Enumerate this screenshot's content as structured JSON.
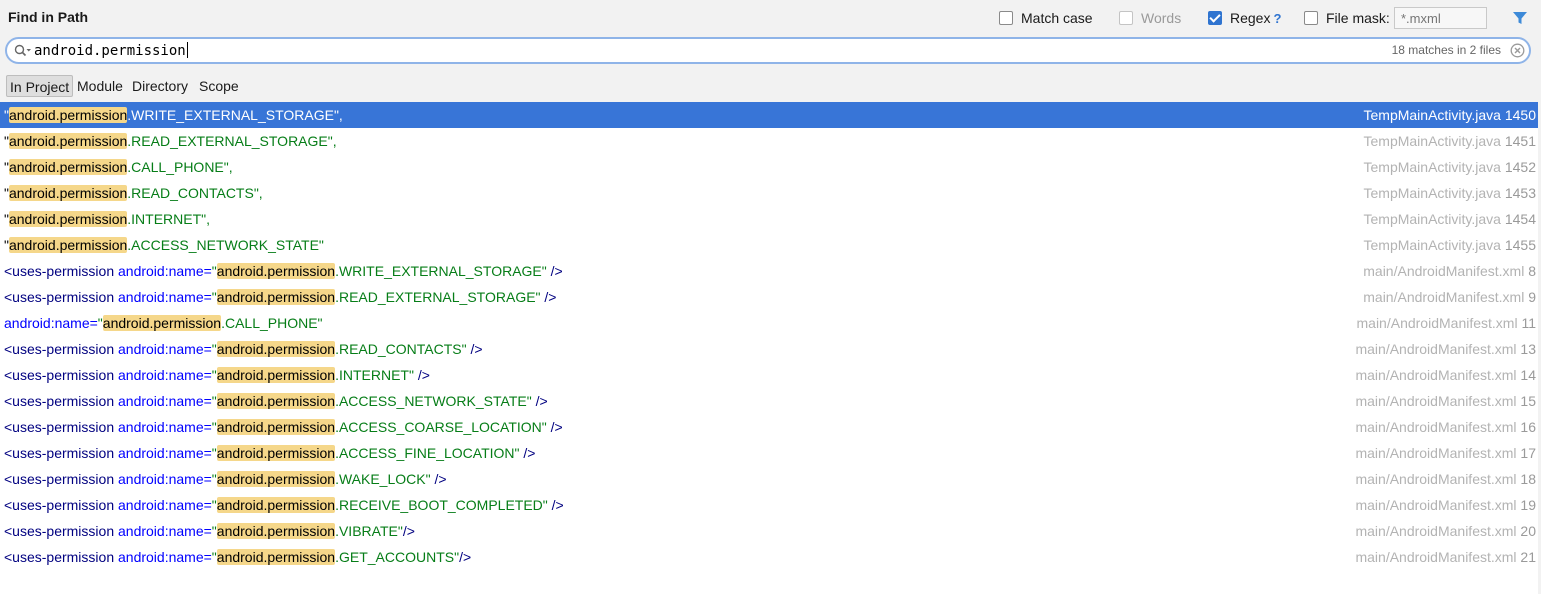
{
  "dialog": {
    "title": "Find in Path",
    "options": {
      "match_case": {
        "label": "Match case",
        "checked": false,
        "disabled": false
      },
      "words": {
        "label": "Words",
        "checked": false,
        "disabled": true
      },
      "regex": {
        "label": "Regex",
        "help": "?",
        "checked": true,
        "disabled": false
      },
      "file_mask": {
        "label": "File mask:",
        "checked": false,
        "placeholder": "*.mxml"
      }
    },
    "filter_icon": "filter-icon"
  },
  "search": {
    "query": "android.permission",
    "match_count": "18 matches in 2 files",
    "icon": "search-icon",
    "clear_icon": "clear-icon"
  },
  "scopes": [
    {
      "label": "In Project",
      "active": true
    },
    {
      "label": "Module",
      "active": false
    },
    {
      "label": "Directory",
      "active": false
    },
    {
      "label": "Scope",
      "active": false
    }
  ],
  "results": [
    {
      "kind": "java",
      "prefix": "\"",
      "match": "android.permission",
      "suffix": ".WRITE_EXTERNAL_STORAGE\",",
      "file": "TempMainActivity.java",
      "line": "1450",
      "selected": true
    },
    {
      "kind": "java",
      "prefix": "\"",
      "match": "android.permission",
      "suffix": ".READ_EXTERNAL_STORAGE\",",
      "file": "TempMainActivity.java",
      "line": "1451"
    },
    {
      "kind": "java",
      "prefix": "\"",
      "match": "android.permission",
      "suffix": ".CALL_PHONE\",",
      "file": "TempMainActivity.java",
      "line": "1452"
    },
    {
      "kind": "java",
      "prefix": "\"",
      "match": "android.permission",
      "suffix": ".READ_CONTACTS\",",
      "file": "TempMainActivity.java",
      "line": "1453"
    },
    {
      "kind": "java",
      "prefix": "\"",
      "match": "android.permission",
      "suffix": ".INTERNET\",",
      "file": "TempMainActivity.java",
      "line": "1454"
    },
    {
      "kind": "java",
      "prefix": "\"",
      "match": "android.permission",
      "suffix": ".ACCESS_NETWORK_STATE\"",
      "file": "TempMainActivity.java",
      "line": "1455"
    },
    {
      "kind": "xml",
      "tag": "<uses-permission ",
      "attr": "android:name=",
      "quote": "\"",
      "match": "android.permission",
      "suffix": ".WRITE_EXTERNAL_STORAGE\"",
      "close": " />",
      "file": "main/AndroidManifest.xml",
      "line": "8"
    },
    {
      "kind": "xml",
      "tag": "<uses-permission ",
      "attr": "android:name=",
      "quote": "\"",
      "match": "android.permission",
      "suffix": ".READ_EXTERNAL_STORAGE\"",
      "close": " />",
      "file": "main/AndroidManifest.xml",
      "line": "9"
    },
    {
      "kind": "xml",
      "tag": "",
      "attr": "android:name=",
      "quote": "\"",
      "match": "android.permission",
      "suffix": ".CALL_PHONE\"",
      "close": "",
      "file": "main/AndroidManifest.xml",
      "line": "11"
    },
    {
      "kind": "xml",
      "tag": "<uses-permission ",
      "attr": "android:name=",
      "quote": "\"",
      "match": "android.permission",
      "suffix": ".READ_CONTACTS\"",
      "close": " />",
      "file": "main/AndroidManifest.xml",
      "line": "13"
    },
    {
      "kind": "xml",
      "tag": "<uses-permission ",
      "attr": "android:name=",
      "quote": "\"",
      "match": "android.permission",
      "suffix": ".INTERNET\"",
      "close": " />",
      "file": "main/AndroidManifest.xml",
      "line": "14"
    },
    {
      "kind": "xml",
      "tag": "<uses-permission ",
      "attr": "android:name=",
      "quote": "\"",
      "match": "android.permission",
      "suffix": ".ACCESS_NETWORK_STATE\"",
      "close": " />",
      "file": "main/AndroidManifest.xml",
      "line": "15"
    },
    {
      "kind": "xml",
      "tag": "<uses-permission ",
      "attr": "android:name=",
      "quote": "\"",
      "match": "android.permission",
      "suffix": ".ACCESS_COARSE_LOCATION\"",
      "close": " />",
      "file": "main/AndroidManifest.xml",
      "line": "16"
    },
    {
      "kind": "xml",
      "tag": "<uses-permission ",
      "attr": "android:name=",
      "quote": "\"",
      "match": "android.permission",
      "suffix": ".ACCESS_FINE_LOCATION\"",
      "close": " />",
      "file": "main/AndroidManifest.xml",
      "line": "17"
    },
    {
      "kind": "xml",
      "tag": "<uses-permission ",
      "attr": "android:name=",
      "quote": "\"",
      "match": "android.permission",
      "suffix": ".WAKE_LOCK\"",
      "close": " />",
      "file": "main/AndroidManifest.xml",
      "line": "18"
    },
    {
      "kind": "xml",
      "tag": "<uses-permission ",
      "attr": "android:name=",
      "quote": "\"",
      "match": "android.permission",
      "suffix": ".RECEIVE_BOOT_COMPLETED\"",
      "close": " />",
      "file": "main/AndroidManifest.xml",
      "line": "19"
    },
    {
      "kind": "xml",
      "tag": "<uses-permission ",
      "attr": "android:name=",
      "quote": "\"",
      "match": "android.permission",
      "suffix": ".VIBRATE\"",
      "close": "/>",
      "file": "main/AndroidManifest.xml",
      "line": "20"
    },
    {
      "kind": "xml",
      "tag": "<uses-permission ",
      "attr": "android:name=",
      "quote": "\"",
      "match": "android.permission",
      "suffix": ".GET_ACCOUNTS\"",
      "close": "/>",
      "file": "main/AndroidManifest.xml",
      "line": "21"
    }
  ],
  "colors": {
    "selection": "#3875d7",
    "highlight": "#f5d78a",
    "string": "#067d17",
    "attribute": "#0000ff",
    "tag": "#000080"
  }
}
